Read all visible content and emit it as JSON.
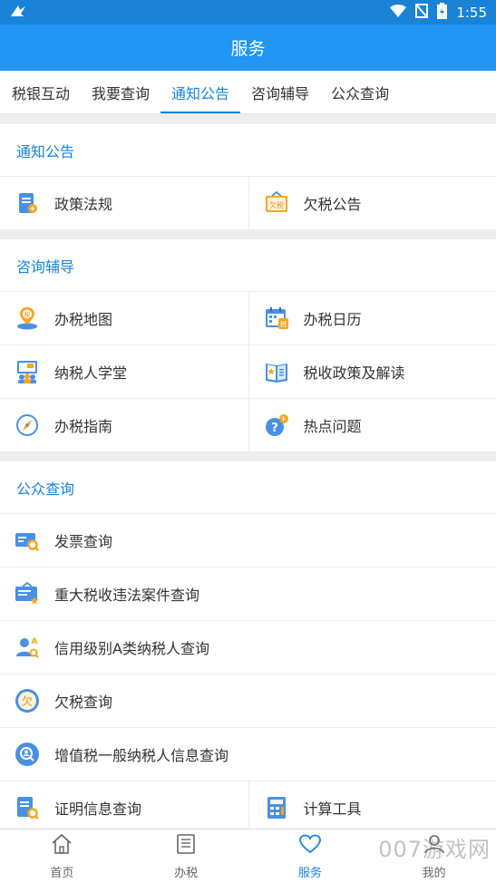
{
  "status_bar": {
    "time": "1:55"
  },
  "app_bar": {
    "title": "服务"
  },
  "tabs": [
    {
      "label": "税银互动"
    },
    {
      "label": "我要查询"
    },
    {
      "label": "通知公告"
    },
    {
      "label": "咨询辅导"
    },
    {
      "label": "公众查询"
    }
  ],
  "sections": {
    "notice": {
      "title": "通知公告",
      "items": [
        {
          "label": "政策法规",
          "icon": "policy-document-icon"
        },
        {
          "label": "欠税公告",
          "icon": "tax-arrears-notice-icon",
          "icon_text": "欠税"
        }
      ]
    },
    "consult": {
      "title": "咨询辅导",
      "items": [
        {
          "label": "办税地图",
          "icon": "map-pin-icon",
          "icon_text": "税"
        },
        {
          "label": "办税日历",
          "icon": "calendar-icon",
          "icon_text": "税"
        },
        {
          "label": "纳税人学堂",
          "icon": "classroom-icon"
        },
        {
          "label": "税收政策及解读",
          "icon": "policy-book-icon"
        },
        {
          "label": "办税指南",
          "icon": "compass-icon"
        },
        {
          "label": "热点问题",
          "icon": "question-icon"
        }
      ]
    },
    "public": {
      "title": "公众查询",
      "items": [
        {
          "label": "发票查询",
          "icon": "invoice-search-icon"
        },
        {
          "label": "重大税收违法案件查询",
          "icon": "case-board-icon"
        },
        {
          "label": "信用级别A类纳税人查询",
          "icon": "credit-user-icon"
        },
        {
          "label": "欠税查询",
          "icon": "arrears-circle-icon",
          "icon_text": "欠"
        },
        {
          "label": "增值税一般纳税人信息查询",
          "icon": "taxpayer-search-icon"
        }
      ],
      "last_row": [
        {
          "label": "证明信息查询",
          "icon": "certificate-icon"
        },
        {
          "label": "计算工具",
          "icon": "calculator-icon"
        }
      ]
    }
  },
  "bottom_nav": [
    {
      "label": "首页",
      "icon": "home-icon"
    },
    {
      "label": "办税",
      "icon": "list-icon"
    },
    {
      "label": "服务",
      "icon": "heart-icon"
    },
    {
      "label": "我的",
      "icon": "user-icon"
    }
  ],
  "watermark": "007游戏网",
  "colors": {
    "primary": "#2196f3",
    "accent": "#1a83d6",
    "orange": "#f5a623"
  }
}
